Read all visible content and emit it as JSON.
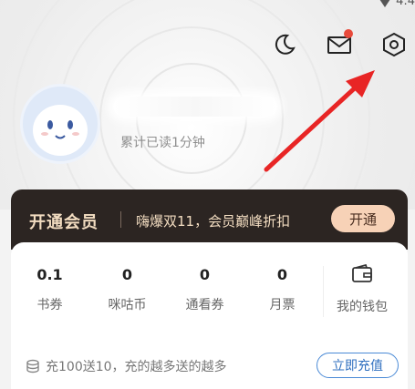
{
  "status": {
    "time": "4:4"
  },
  "profile": {
    "read_time": "累计已读1分钟"
  },
  "vip": {
    "title": "开通会员",
    "promo": "嗨爆双11，会员巅峰折扣",
    "button": "开通"
  },
  "wallet": {
    "stats": [
      {
        "value": "0.1",
        "label": "书券"
      },
      {
        "value": "0",
        "label": "咪咕币"
      },
      {
        "value": "0",
        "label": "通看券"
      },
      {
        "value": "0",
        "label": "月票"
      }
    ],
    "my_wallet_label": "我的钱包",
    "recharge_text": "充100送10，充的越多送的越多",
    "recharge_button": "立即充值"
  },
  "icons": [
    "moon-icon",
    "mail-icon",
    "settings-hexagon-icon",
    "wallet-icon",
    "coins-icon"
  ],
  "colors": {
    "accent": "#e82525",
    "vip_bg": "#2c2522",
    "vip_gold": "#f2dcc0",
    "recharge_blue": "#2f6fbf"
  }
}
